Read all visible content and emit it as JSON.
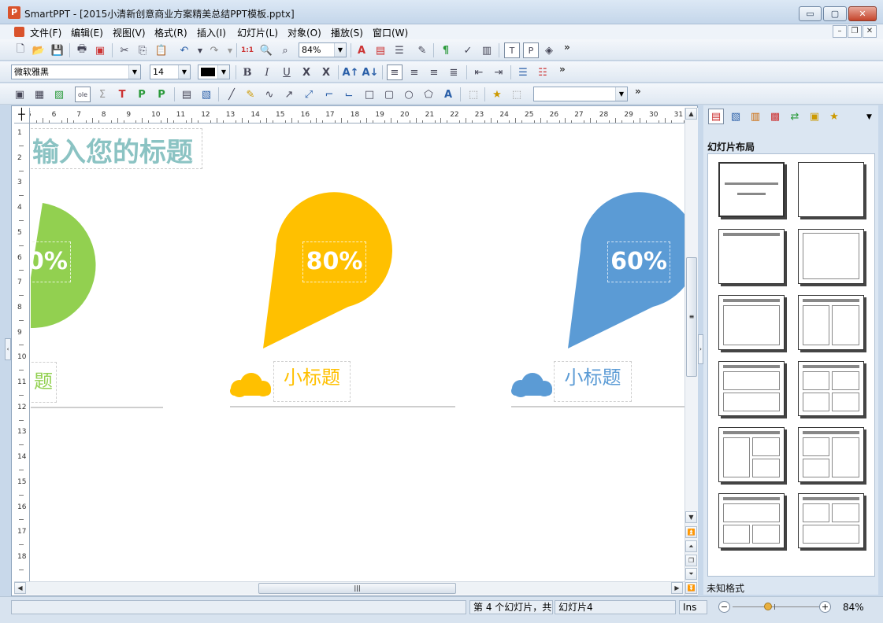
{
  "window": {
    "app_icon": "P",
    "title": "SmartPPT - [2015小清新创意商业方案精美总结PPT模板.pptx]",
    "min_glyph": "▭",
    "max_glyph": "▢",
    "close_glyph": "✕"
  },
  "menu": {
    "items": [
      "文件(F)",
      "编辑(E)",
      "视图(V)",
      "格式(R)",
      "插入(I)",
      "幻灯片(L)",
      "对象(O)",
      "播放(S)",
      "窗口(W)"
    ],
    "doc_min": "–",
    "doc_restore": "❐",
    "doc_close": "✕"
  },
  "toolbar1": {
    "zoom": "84%",
    "more": "»"
  },
  "toolbar2": {
    "font_name": "微软雅黑",
    "font_size": "14",
    "bold": "B",
    "italic": "I",
    "underline": "U",
    "strike1": "X",
    "strike2": "X",
    "more": "»"
  },
  "toolbar3": {
    "combo_value": "",
    "more": "»"
  },
  "ruler": {
    "h": [
      "5",
      "6",
      "7",
      "8",
      "9",
      "10",
      "11",
      "12",
      "13",
      "14",
      "15",
      "16",
      "17",
      "18",
      "19",
      "20",
      "21",
      "22",
      "23",
      "24",
      "25",
      "26",
      "27",
      "28",
      "29",
      "30",
      "31"
    ],
    "v": [
      "1",
      "2",
      "3",
      "4",
      "5",
      "6",
      "7",
      "8",
      "9",
      "10",
      "11",
      "12",
      "13",
      "14",
      "15",
      "16",
      "17",
      "18"
    ]
  },
  "slide": {
    "title": "输入您的标题",
    "drops": [
      {
        "percent": "0%",
        "subtitle": "题",
        "color": "#92d050"
      },
      {
        "percent": "80%",
        "subtitle": "小标题",
        "color": "#ffc000"
      },
      {
        "percent": "60%",
        "subtitle": "小标题",
        "color": "#5b9bd5"
      }
    ]
  },
  "panel": {
    "title": "幻灯片布局",
    "status": "未知格式",
    "tab_dropdown": "▼"
  },
  "status": {
    "left": "",
    "slide_info": "第 4 个幻灯片，共",
    "slide_name": "幻灯片4",
    "ins": "Ins",
    "zoom_minus": "−",
    "zoom_plus": "+",
    "zoom_pct": "84%",
    "zoom_level_percent": 84
  },
  "colors": {
    "title_color": "#8bc3c3",
    "green": "#92d050",
    "orange": "#ffc000",
    "blue": "#5b9bd5",
    "line": "#9e9e9e"
  }
}
